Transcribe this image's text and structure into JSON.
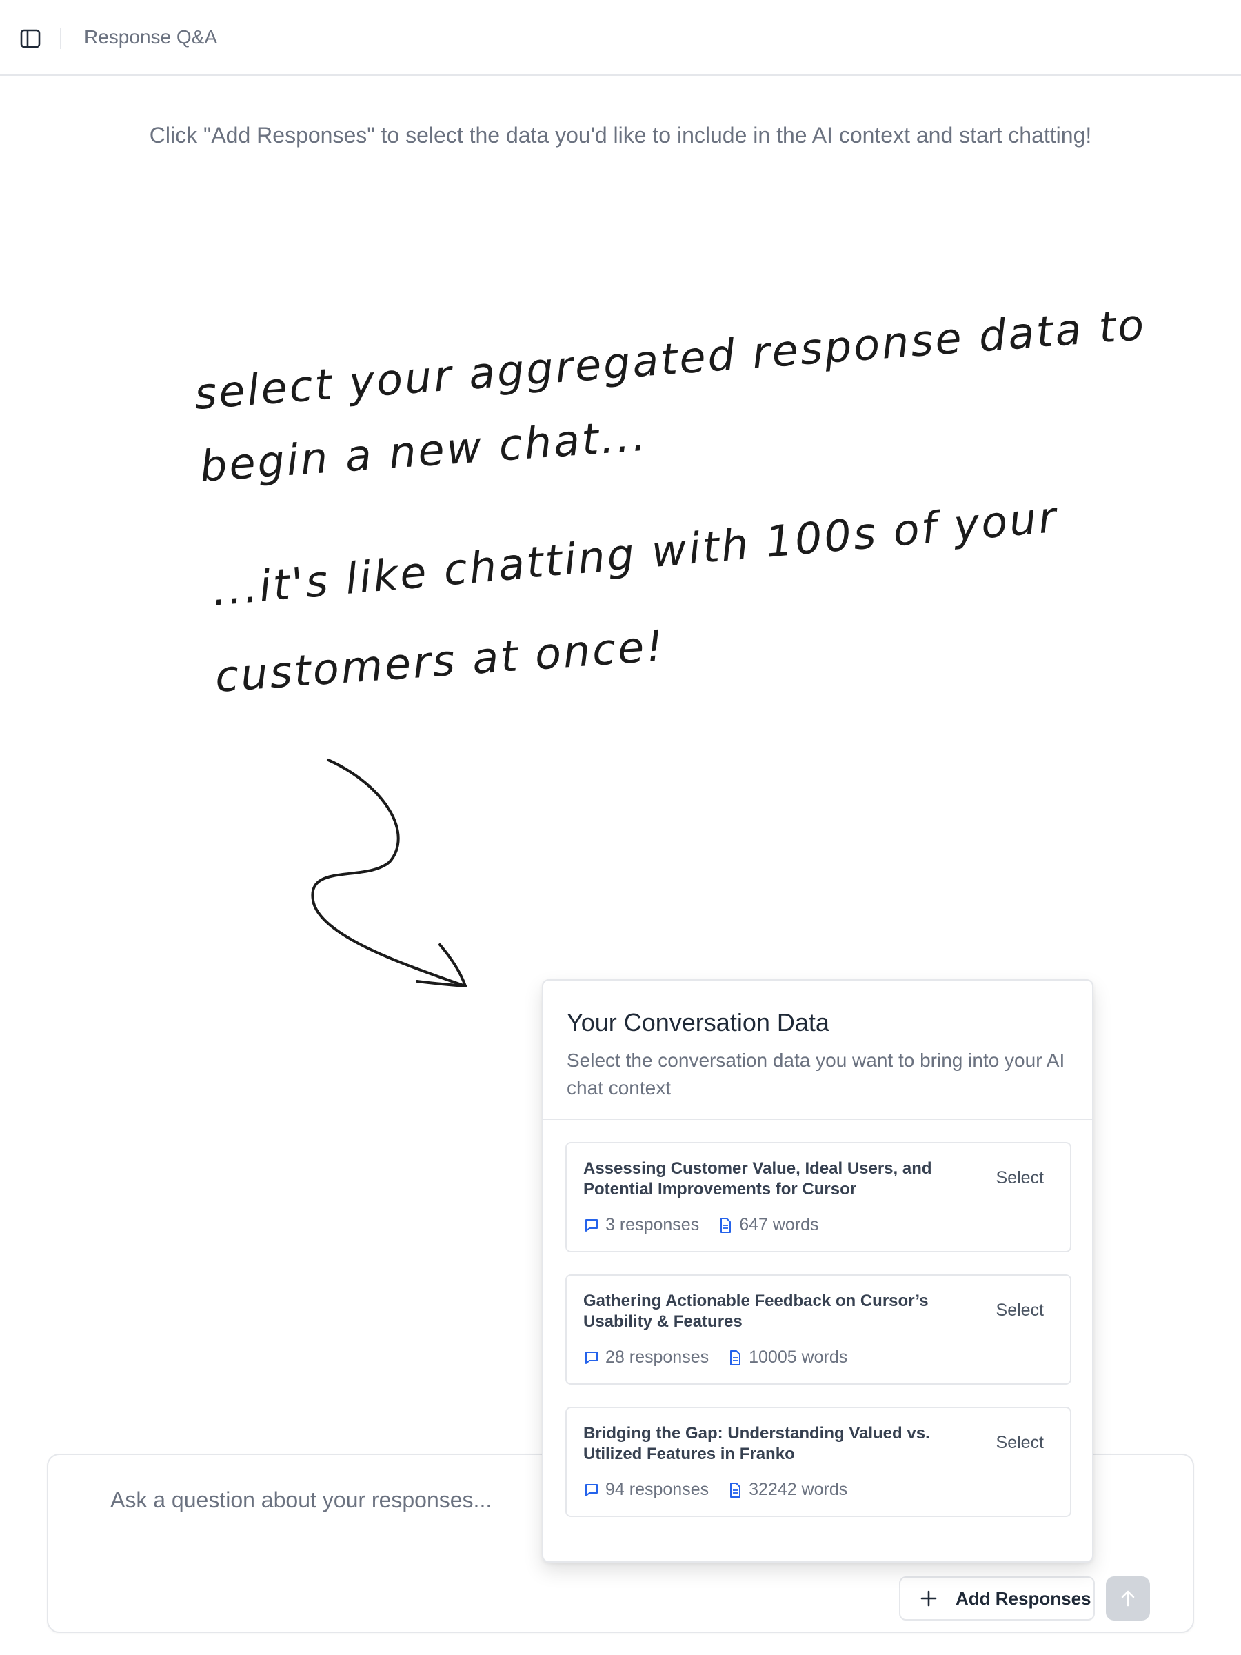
{
  "header": {
    "title": "Response Q&A",
    "toggle_icon": "sidebar-toggle-icon"
  },
  "intro_text": "Click \"Add Responses\" to select the data you'd like to include in the AI context and start chatting!",
  "annotation": {
    "line1": "select your aggregated response data to",
    "line2": "begin a new chat...",
    "line3": "...it's like chatting with 100s of your",
    "line4": "customers at once!"
  },
  "popover": {
    "title": "Your Conversation Data",
    "subtitle": "Select the conversation data you want to bring into your AI chat context",
    "select_label": "Select",
    "items": [
      {
        "title": "Assessing Customer Value, Ideal Users, and Potential Improvements for Cursor",
        "responses": "3 responses",
        "words": "647 words"
      },
      {
        "title": "Gathering Actionable Feedback on Cursor’s Usability & Features",
        "responses": "28 responses",
        "words": "10005 words"
      },
      {
        "title": "Bridging the Gap: Understanding Valued vs. Utilized Features in Franko",
        "responses": "94 responses",
        "words": "32242 words"
      }
    ]
  },
  "chat": {
    "placeholder": "Ask a question about your responses...",
    "add_responses_label": "Add Responses",
    "send_icon": "arrow-up-icon"
  },
  "colors": {
    "accent_icon": "#2563eb",
    "border": "#e5e7eb",
    "muted_text": "#6b7280",
    "send_disabled": "#d1d5db"
  }
}
